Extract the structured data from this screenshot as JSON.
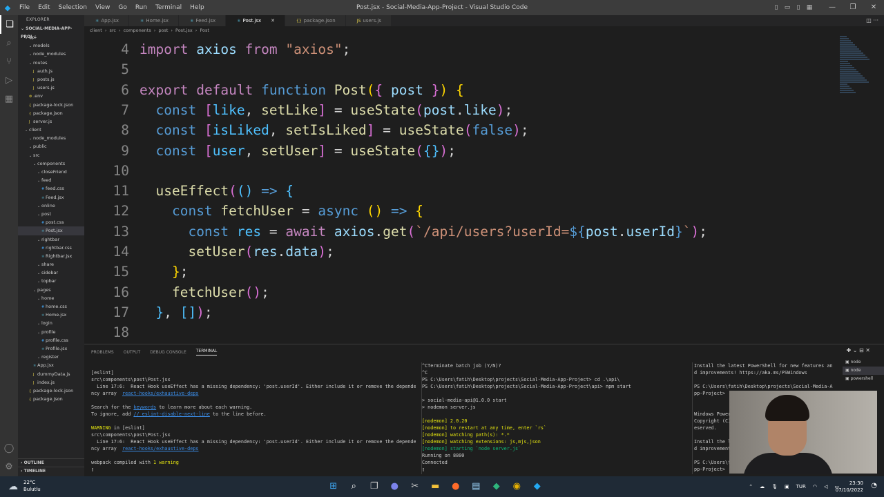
{
  "window": {
    "title": "Post.jsx - Social-Media-App-Project - Visual Studio Code",
    "menu": [
      "File",
      "Edit",
      "Selection",
      "View",
      "Go",
      "Run",
      "Terminal",
      "Help"
    ]
  },
  "explorer": {
    "header": "EXPLORER",
    "root": "SOCIAL-MEDIA-APP-PROJ...",
    "items": [
      {
        "label": "api",
        "depth": 1,
        "type": "folder"
      },
      {
        "label": "models",
        "depth": 2,
        "type": "folder"
      },
      {
        "label": "node_modules",
        "depth": 2,
        "type": "folder"
      },
      {
        "label": "routes",
        "depth": 2,
        "type": "folder"
      },
      {
        "label": "auth.js",
        "depth": 3,
        "type": "js"
      },
      {
        "label": "posts.js",
        "depth": 3,
        "type": "js"
      },
      {
        "label": "users.js",
        "depth": 3,
        "type": "js"
      },
      {
        "label": ".env",
        "depth": 2,
        "type": "env"
      },
      {
        "label": "package-lock.json",
        "depth": 2,
        "type": "json"
      },
      {
        "label": "package.json",
        "depth": 2,
        "type": "json"
      },
      {
        "label": "server.js",
        "depth": 2,
        "type": "js"
      },
      {
        "label": "client",
        "depth": 1,
        "type": "folder"
      },
      {
        "label": "node_modules",
        "depth": 2,
        "type": "folder"
      },
      {
        "label": "public",
        "depth": 2,
        "type": "folder"
      },
      {
        "label": "src",
        "depth": 2,
        "type": "folder"
      },
      {
        "label": "components",
        "depth": 3,
        "type": "folder"
      },
      {
        "label": "closeFriend",
        "depth": 4,
        "type": "folder"
      },
      {
        "label": "feed",
        "depth": 4,
        "type": "folder"
      },
      {
        "label": "feed.css",
        "depth": 5,
        "type": "css"
      },
      {
        "label": "Feed.jsx",
        "depth": 5,
        "type": "jsx"
      },
      {
        "label": "online",
        "depth": 4,
        "type": "folder"
      },
      {
        "label": "post",
        "depth": 4,
        "type": "folder"
      },
      {
        "label": "post.css",
        "depth": 5,
        "type": "css"
      },
      {
        "label": "Post.jsx",
        "depth": 5,
        "type": "jsx",
        "selected": true
      },
      {
        "label": "rightbar",
        "depth": 4,
        "type": "folder"
      },
      {
        "label": "rightbar.css",
        "depth": 5,
        "type": "css"
      },
      {
        "label": "Rightbar.jsx",
        "depth": 5,
        "type": "jsx"
      },
      {
        "label": "share",
        "depth": 4,
        "type": "folder"
      },
      {
        "label": "sidebar",
        "depth": 4,
        "type": "folder"
      },
      {
        "label": "topbar",
        "depth": 4,
        "type": "folder"
      },
      {
        "label": "pages",
        "depth": 3,
        "type": "folder"
      },
      {
        "label": "home",
        "depth": 4,
        "type": "folder"
      },
      {
        "label": "home.css",
        "depth": 5,
        "type": "css"
      },
      {
        "label": "Home.jsx",
        "depth": 5,
        "type": "jsx"
      },
      {
        "label": "login",
        "depth": 4,
        "type": "folder"
      },
      {
        "label": "profile",
        "depth": 4,
        "type": "folder"
      },
      {
        "label": "profile.css",
        "depth": 5,
        "type": "css"
      },
      {
        "label": "Profile.jsx",
        "depth": 5,
        "type": "jsx"
      },
      {
        "label": "register",
        "depth": 4,
        "type": "folder"
      },
      {
        "label": "App.jsx",
        "depth": 3,
        "type": "jsx"
      },
      {
        "label": "dummyData.js",
        "depth": 3,
        "type": "js"
      },
      {
        "label": "index.js",
        "depth": 3,
        "type": "js"
      },
      {
        "label": "package-lock.json",
        "depth": 2,
        "type": "json"
      },
      {
        "label": "package.json",
        "depth": 2,
        "type": "json"
      }
    ],
    "outline": "OUTLINE",
    "timeline": "TIMELINE"
  },
  "tabs": [
    {
      "label": "App.jsx",
      "icon": "jsx",
      "active": false
    },
    {
      "label": "Home.jsx",
      "icon": "jsx",
      "active": false
    },
    {
      "label": "Feed.jsx",
      "icon": "jsx",
      "active": false
    },
    {
      "label": "Post.jsx",
      "icon": "jsx",
      "active": true
    },
    {
      "label": "package.json",
      "icon": "json",
      "active": false
    },
    {
      "label": "users.js",
      "icon": "js",
      "active": false
    }
  ],
  "breadcrumb": [
    "client",
    "src",
    "components",
    "post",
    "Post.jsx",
    "Post"
  ],
  "editor": {
    "lines": [
      {
        "n": "4",
        "html": "<span class='k'>import</span> <span class='v'>axios</span> <span class='k'>from</span> <span class='s'>\"axios\"</span><span class='p'>;</span>"
      },
      {
        "n": "5",
        "html": ""
      },
      {
        "n": "6",
        "html": "<span class='k'>export</span> <span class='k'>default</span> <span class='b'>function</span> <span class='f'>Post</span><span class='y'>(</span><span class='m'>{</span> <span class='v'>post</span> <span class='m'>}</span><span class='y'>)</span> <span class='y'>{</span>"
      },
      {
        "n": "7",
        "html": "  <span class='b'>const</span> <span class='m'>[</span><span class='c'>like</span><span class='p'>,</span> <span class='f'>setLike</span><span class='m'>]</span> <span class='p'>=</span> <span class='f'>useState</span><span class='m'>(</span><span class='v'>post</span><span class='p'>.</span><span class='v'>like</span><span class='m'>)</span><span class='p'>;</span>"
      },
      {
        "n": "8",
        "html": "  <span class='b'>const</span> <span class='m'>[</span><span class='c'>isLiked</span><span class='p'>,</span> <span class='f'>setIsLiked</span><span class='m'>]</span> <span class='p'>=</span> <span class='f'>useState</span><span class='m'>(</span><span class='b'>false</span><span class='m'>)</span><span class='p'>;</span>"
      },
      {
        "n": "9",
        "html": "  <span class='b'>const</span> <span class='m'>[</span><span class='c'>user</span><span class='p'>,</span> <span class='f'>setUser</span><span class='m'>]</span> <span class='p'>=</span> <span class='f'>useState</span><span class='m'>(</span><span class='c'>{}</span><span class='m'>)</span><span class='p'>;</span>"
      },
      {
        "n": "10",
        "html": ""
      },
      {
        "n": "11",
        "html": "  <span class='f'>useEffect</span><span class='m'>(</span><span class='c'>()</span> <span class='b'>=&gt;</span> <span class='c'>{</span>"
      },
      {
        "n": "12",
        "html": "    <span class='b'>const</span> <span class='f'>fetchUser</span> <span class='p'>=</span> <span class='b'>async</span> <span class='y'>()</span> <span class='b'>=&gt;</span> <span class='y'>{</span>"
      },
      {
        "n": "13",
        "html": "      <span class='b'>const</span> <span class='c'>res</span> <span class='p'>=</span> <span class='k'>await</span> <span class='v'>axios</span><span class='p'>.</span><span class='f'>get</span><span class='m'>(</span><span class='s'>`/api/users?userId=</span><span class='b'>${</span><span class='v'>post</span><span class='p'>.</span><span class='v'>userId</span><span class='b'>}</span><span class='s'>`</span><span class='m'>)</span><span class='p'>;</span>"
      },
      {
        "n": "14",
        "html": "      <span class='f'>setUser</span><span class='m'>(</span><span class='v'>res</span><span class='p'>.</span><span class='v'>data</span><span class='m'>)</span><span class='p'>;</span>"
      },
      {
        "n": "15",
        "html": "    <span class='y'>}</span><span class='p'>;</span>"
      },
      {
        "n": "16",
        "html": "    <span class='f'>fetchUser</span><span class='m'>()</span><span class='p'>;</span>"
      },
      {
        "n": "17",
        "html": "  <span class='c'>}</span><span class='p'>,</span> <span class='c'>[]</span><span class='m'>)</span><span class='p'>;</span>"
      },
      {
        "n": "18",
        "html": ""
      }
    ]
  },
  "panel": {
    "tabs": [
      "PROBLEMS",
      "OUTPUT",
      "DEBUG CONSOLE",
      "TERMINAL"
    ],
    "active_tab": "TERMINAL",
    "terminal_list": [
      "node",
      "node",
      "powershell"
    ],
    "term1": [
      "",
      "[eslint]",
      "src\\components\\post\\Post.jsx",
      "  Line 17:6:  React Hook useEffect has a missing dependency: 'post.userId'. Either include it or remove the depende",
      "ncy array  <span class='tl'>react-hooks/exhaustive-deps</span>",
      "",
      "Search for the <span class='tl'>keywords</span> to learn more about each warning.",
      "To ignore, add <span class='tl'>// eslint-disable-next-line</span> to the line before.",
      "",
      "<span class='tyl'>WARNING</span> in [eslint]",
      "src\\components\\post\\Post.jsx",
      "  Line 17:6:  React Hook useEffect has a missing dependency: 'post.userId'. Either include it or remove the depende",
      "ncy array  <span class='tl'>react-hooks/exhaustive-deps</span>",
      "",
      "webpack compiled with <span class='tyl'>1 warning</span>",
      "▯"
    ],
    "term2": [
      "^CTerminate batch job (Y/N)?",
      "^C",
      "PS C:\\Users\\fatih\\Desktop\\projects\\Social-Media-App-Project> cd .\\api\\",
      "PS C:\\Users\\fatih\\Desktop\\projects\\Social-Media-App-Project\\api> npm start",
      "",
      "> social-media-api@1.0.0 start",
      "> nodemon server.js",
      "",
      "<span class='tyl'>[nodemon] 2.0.20</span>",
      "<span class='tyl'>[nodemon] to restart at any time, enter `rs`</span>",
      "<span class='tyl'>[nodemon] watching path(s): *.*</span>",
      "<span class='tyl'>[nodemon] watching extensions: js,mjs,json</span>",
      "<span class='tg'>[nodemon] starting `node server.js`</span>",
      "Running on 8800",
      "Connected",
      "▯"
    ],
    "term3": [
      "Install the latest PowerShell for new features an",
      "d improvements! https://aka.ms/PSWindows",
      "",
      "PS C:\\Users\\fatih\\Desktop\\projects\\Social-Media-A",
      "pp-Project>",
      "",
      "",
      "Windows Power",
      "Copyright (C)",
      "eserved.",
      "",
      "Install the l",
      "d improvement",
      "",
      "PS C:\\Users\\f",
      "pp-Project>"
    ]
  },
  "taskbar": {
    "temp": "22°C",
    "weather": "Bulutlu",
    "lang": "TUR",
    "time": "23:30",
    "date": "07/10/2022"
  }
}
